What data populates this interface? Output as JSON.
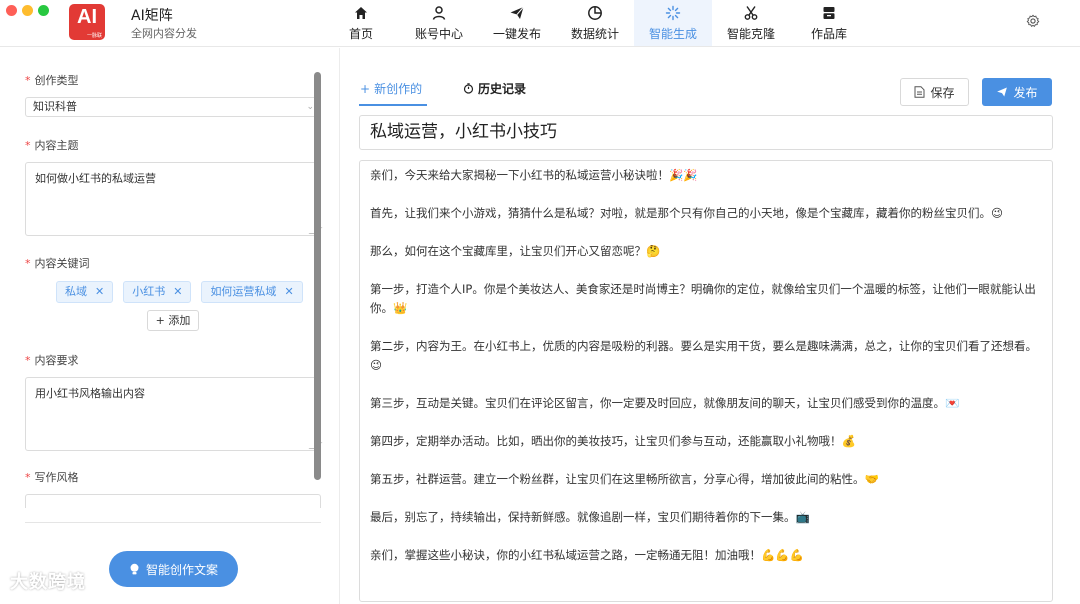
{
  "app": {
    "logo": "AI",
    "logo_sub": "一脉联",
    "name": "AI矩阵",
    "subtitle": "全网内容分发"
  },
  "nav": [
    {
      "label": "首页",
      "icon": "home-icon"
    },
    {
      "label": "账号中心",
      "icon": "user-icon"
    },
    {
      "label": "一键发布",
      "icon": "send-icon"
    },
    {
      "label": "数据统计",
      "icon": "pie-chart-icon"
    },
    {
      "label": "智能生成",
      "icon": "spinner-icon",
      "active": true
    },
    {
      "label": "智能克隆",
      "icon": "scissors-icon"
    },
    {
      "label": "作品库",
      "icon": "library-icon"
    }
  ],
  "form": {
    "type_label": "创作类型",
    "type_value": "知识科普",
    "topic_label": "内容主题",
    "topic_value": "如何做小红书的私域运营",
    "keywords_label": "内容关键词",
    "keywords": [
      "私域",
      "小红书",
      "如何运营私域"
    ],
    "add_label": "+ 添加",
    "requirement_label": "内容要求",
    "requirement_value": "用小红书风格输出内容",
    "style_label": "写作风格",
    "generate_label": "智能创作文案"
  },
  "watermark": "大数跨境",
  "editor": {
    "tab_new": "新创作的",
    "tab_history": "历史记录",
    "save_label": "保存",
    "publish_label": "发布",
    "title": "私域运营，小红书小技巧",
    "paragraphs": [
      "亲们，今天来给大家揭秘一下小红书的私域运营小秘诀啦！🎉🎉",
      "首先，让我们来个小游戏，猜猜什么是私域？对啦，就是那个只有你自己的小天地，像是个宝藏库，藏着你的粉丝宝贝们。😉",
      "那么，如何在这个宝藏库里，让宝贝们开心又留恋呢？🤔",
      "第一步，打造个人IP。你是个美妆达人、美食家还是时尚博主？明确你的定位，就像给宝贝们一个温暖的标签，让他们一眼就能认出你。👑",
      "第二步，内容为王。在小红书上，优质的内容是吸粉的利器。要么是实用干货，要么是趣味满满，总之，让你的宝贝们看了还想看。😉",
      "第三步，互动是关键。宝贝们在评论区留言，你一定要及时回应，就像朋友间的聊天，让宝贝们感受到你的温度。💌",
      "第四步，定期举办活动。比如，晒出你的美妆技巧，让宝贝们参与互动，还能赢取小礼物哦！💰",
      "第五步，社群运营。建立一个粉丝群，让宝贝们在这里畅所欲言，分享心得，增加彼此间的粘性。🤝",
      "最后，别忘了，持续输出，保持新鲜感。就像追剧一样，宝贝们期待着你的下一集。📺",
      "亲们，掌握这些小秘诀，你的小红书私域运营之路，一定畅通无阻！加油哦！💪💪💪"
    ]
  }
}
